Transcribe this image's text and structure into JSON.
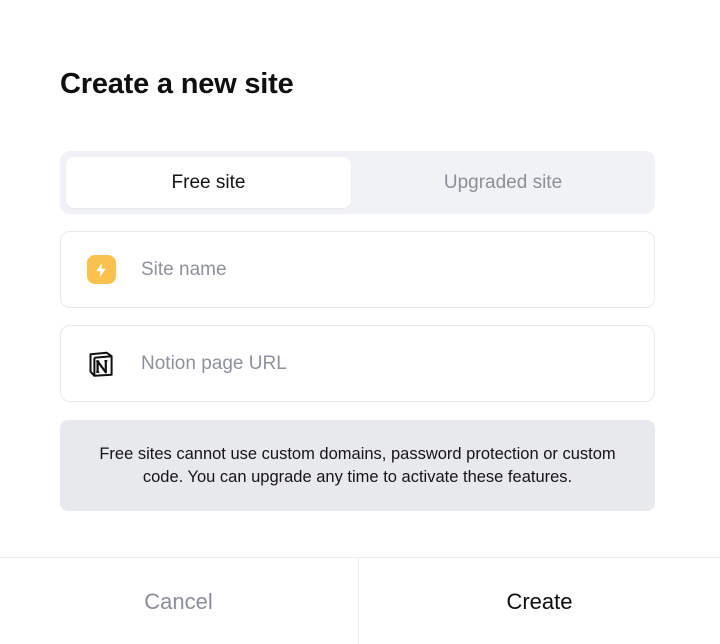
{
  "dialog": {
    "title": "Create a new site"
  },
  "site_type": {
    "options": [
      {
        "label": "Free site",
        "selected": true
      },
      {
        "label": "Upgraded site",
        "selected": false
      }
    ]
  },
  "fields": {
    "site_name": {
      "placeholder": "Site name",
      "value": "",
      "icon": "lightning-bolt-icon"
    },
    "notion_url": {
      "placeholder": "Notion page URL",
      "value": "",
      "icon": "notion-logo-icon"
    }
  },
  "notice": {
    "text": "Free sites cannot use custom domains, password protection or custom code. You can upgrade any time to activate these features."
  },
  "footer": {
    "cancel_label": "Cancel",
    "create_label": "Create"
  },
  "colors": {
    "accent_bolt": "#f9c14d",
    "segment_bg": "#f1f2f6",
    "notice_bg": "#e8e9ed",
    "muted_text": "#8a8f98"
  }
}
